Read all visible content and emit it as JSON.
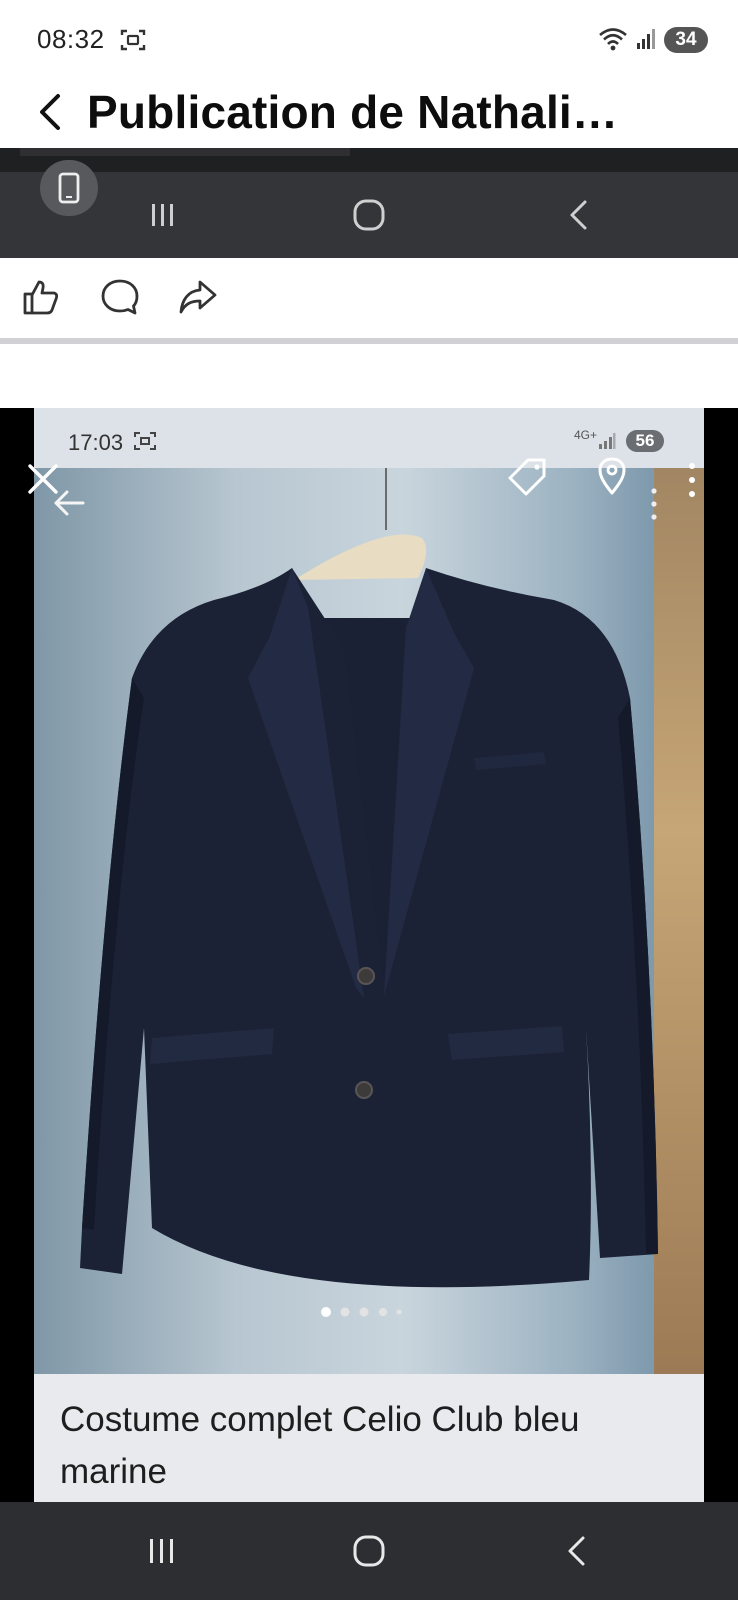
{
  "status_bar": {
    "time": "08:32",
    "battery": "34",
    "icons": [
      "screen-record-icon",
      "wifi-icon",
      "signal-icon"
    ]
  },
  "header": {
    "title": "Publication de Nathali…",
    "back_icon": "chevron-left-icon"
  },
  "action_bar": {
    "icons": [
      "like-icon",
      "comment-icon",
      "share-icon"
    ]
  },
  "photo": {
    "embedded_status_time": "17:03",
    "embedded_battery": "56",
    "embedded_network": "4G+",
    "overlay_icons": [
      "close-icon",
      "back-arrow-icon",
      "tag-icon",
      "location-icon",
      "more-icon"
    ],
    "caption": "Costume complet Celio Club bleu marine",
    "pager_dots": 5,
    "pager_active": 1
  },
  "nav_bar": {
    "icons": [
      "recents-icon",
      "home-icon",
      "back-icon"
    ]
  },
  "colors": {
    "nav_dark": "#2d2e31",
    "jacket": "#1c2236",
    "background": "#ffffff"
  }
}
